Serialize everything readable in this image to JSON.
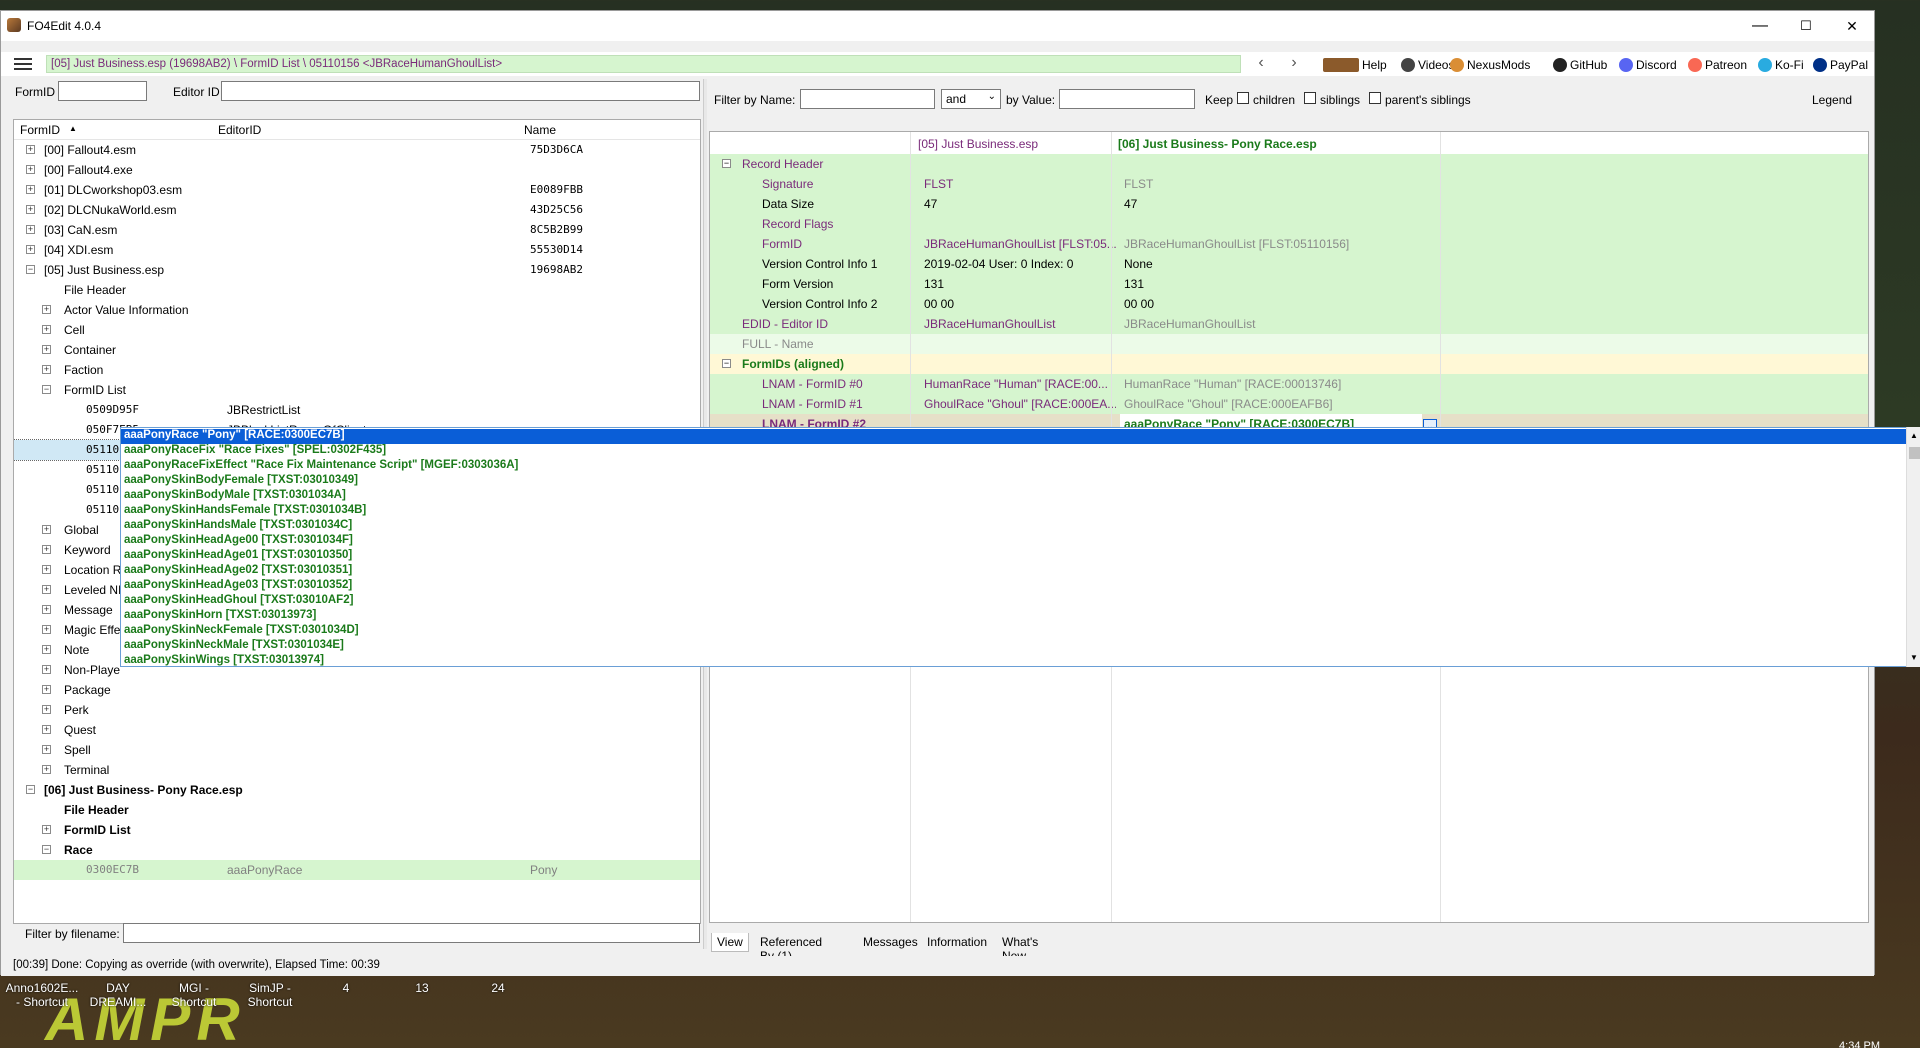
{
  "window": {
    "title": "FO4Edit 4.0.4",
    "min": "—",
    "max": "☐",
    "close": "✕"
  },
  "toolbar": {
    "path": "[05] Just Business.esp (19698AB2) \\ FormID List \\ 05110156 <JBRaceHumanGhoulList>",
    "back": "‹",
    "forward": "›",
    "links": [
      {
        "label": "Help",
        "icon": "book-icon"
      },
      {
        "label": "Videos",
        "icon": "videos-icon"
      },
      {
        "label": "NexusMods",
        "icon": "nexusmods-icon"
      },
      {
        "label": "GitHub",
        "icon": "github-icon"
      },
      {
        "label": "Discord",
        "icon": "discord-icon"
      },
      {
        "label": "Patreon",
        "icon": "patreon-icon"
      },
      {
        "label": "Ko-Fi",
        "icon": "kofi-icon"
      },
      {
        "label": "PayPal",
        "icon": "paypal-icon"
      }
    ]
  },
  "left": {
    "formid_label": "FormID",
    "editorid_label": "Editor ID",
    "formid_value": "",
    "editorid_value": "",
    "columns": [
      "FormID",
      "EditorID",
      "Name"
    ],
    "rows": [
      {
        "text": "[00] Fallout4.esm",
        "name": "75D3D6CA",
        "exp": "+",
        "indent": 0
      },
      {
        "text": "[00] Fallout4.exe",
        "name": "",
        "exp": "+",
        "indent": 0
      },
      {
        "text": "[01] DLCworkshop03.esm",
        "name": "E0089FBB",
        "exp": "+",
        "indent": 0
      },
      {
        "text": "[02] DLCNukaWorld.esm",
        "name": "43D25C56",
        "exp": "+",
        "indent": 0
      },
      {
        "text": "[03] CaN.esm",
        "name": "8C5B2B99",
        "exp": "+",
        "indent": 0
      },
      {
        "text": "[04] XDI.esm",
        "name": "55530D14",
        "exp": "+",
        "indent": 0
      },
      {
        "text": "[05] Just Business.esp",
        "name": "19698AB2",
        "exp": "−",
        "indent": 0
      },
      {
        "text": "File Header",
        "name": "",
        "exp": "",
        "indent": 1
      },
      {
        "text": "Actor Value Information",
        "name": "",
        "exp": "+",
        "indent": 1
      },
      {
        "text": "Cell",
        "name": "",
        "exp": "+",
        "indent": 1
      },
      {
        "text": "Container",
        "name": "",
        "exp": "+",
        "indent": 1
      },
      {
        "text": "Faction",
        "name": "",
        "exp": "+",
        "indent": 1
      },
      {
        "text": "FormID List",
        "name": "",
        "exp": "−",
        "indent": 1
      },
      {
        "text": "0509D95F",
        "editor": "JBRestrictList",
        "name": "",
        "exp": "",
        "indent": 2,
        "mono": true
      },
      {
        "text": "050F7EB5",
        "editor": "JBBlackListRacesOfClients",
        "name": "",
        "exp": "",
        "indent": 2,
        "mono": true
      },
      {
        "text": "05110",
        "editor": "",
        "name": "",
        "exp": "",
        "indent": 2,
        "mono": true,
        "selected": true
      },
      {
        "text": "05110",
        "editor": "",
        "name": "",
        "exp": "",
        "indent": 2,
        "mono": true
      },
      {
        "text": "05110",
        "editor": "",
        "name": "",
        "exp": "",
        "indent": 2,
        "mono": true
      },
      {
        "text": "05110",
        "editor": "",
        "name": "",
        "exp": "",
        "indent": 2,
        "mono": true
      },
      {
        "text": "Global",
        "name": "",
        "exp": "+",
        "indent": 1
      },
      {
        "text": "Keyword",
        "name": "",
        "exp": "+",
        "indent": 1
      },
      {
        "text": "Location R",
        "name": "",
        "exp": "+",
        "indent": 1
      },
      {
        "text": "Leveled NI",
        "name": "",
        "exp": "+",
        "indent": 1
      },
      {
        "text": "Message",
        "name": "",
        "exp": "+",
        "indent": 1
      },
      {
        "text": "Magic Effe",
        "name": "",
        "exp": "+",
        "indent": 1
      },
      {
        "text": "Note",
        "name": "",
        "exp": "+",
        "indent": 1
      },
      {
        "text": "Non-Playe",
        "name": "",
        "exp": "+",
        "indent": 1
      },
      {
        "text": "Package",
        "name": "",
        "exp": "+",
        "indent": 1
      },
      {
        "text": "Perk",
        "name": "",
        "exp": "+",
        "indent": 1
      },
      {
        "text": "Quest",
        "name": "",
        "exp": "+",
        "indent": 1
      },
      {
        "text": "Spell",
        "name": "",
        "exp": "+",
        "indent": 1
      },
      {
        "text": "Terminal",
        "name": "",
        "exp": "+",
        "indent": 1
      },
      {
        "text": "[06] Just Business- Pony Race.esp",
        "name": "",
        "exp": "−",
        "indent": 0,
        "bold": true
      },
      {
        "text": "File Header",
        "name": "",
        "exp": "",
        "indent": 1,
        "bold": true
      },
      {
        "text": "FormID List",
        "name": "",
        "exp": "+",
        "indent": 1,
        "bold": true
      },
      {
        "text": "Race",
        "name": "",
        "exp": "−",
        "indent": 1,
        "bold": true
      },
      {
        "text": "0300EC7B",
        "editor": "aaaPonyRace",
        "name": "Pony",
        "exp": "",
        "indent": 2,
        "mono": true,
        "gray": true,
        "highlight": true
      }
    ],
    "filter_label": "Filter by filename:",
    "filter_value": ""
  },
  "right": {
    "filter_name_label": "Filter by Name:",
    "filter_name_value": "",
    "and_select": "and",
    "by_value_label": "by Value:",
    "by_value_value": "",
    "keep_label": "Keep",
    "children": "children",
    "siblings": "siblings",
    "parents": "parent's siblings",
    "legend": "Legend",
    "headers": [
      "[05] Just Business.esp",
      "[06] Just Business- Pony Race.esp"
    ],
    "rows": [
      {
        "label": "Record Header",
        "v1": "",
        "v2": "",
        "indent": 0,
        "exp": "−",
        "bg": "green",
        "lc": "purple"
      },
      {
        "label": "Signature",
        "v1": "FLST",
        "v2": "FLST",
        "indent": 1,
        "bg": "green",
        "lc": "purple",
        "c1": "purple",
        "c2": "grey"
      },
      {
        "label": "Data Size",
        "v1": "47",
        "v2": "47",
        "indent": 1,
        "bg": "green",
        "lc": "black",
        "c1": "black",
        "c2": "black"
      },
      {
        "label": "Record Flags",
        "v1": "",
        "v2": "",
        "indent": 1,
        "bg": "green",
        "lc": "purple"
      },
      {
        "label": "FormID",
        "v1": "JBRaceHumanGhoulList [FLST:05...",
        "v2": "JBRaceHumanGhoulList [FLST:05110156]",
        "indent": 1,
        "bg": "green",
        "lc": "purple",
        "c1": "purple",
        "c2": "grey"
      },
      {
        "label": "Version Control Info 1",
        "v1": "2019-02-04 User: 0 Index: 0",
        "v2": "None",
        "indent": 1,
        "bg": "green",
        "lc": "black",
        "c1": "black",
        "c2": "black"
      },
      {
        "label": "Form Version",
        "v1": "131",
        "v2": "131",
        "indent": 1,
        "bg": "green",
        "lc": "black",
        "c1": "black",
        "c2": "black"
      },
      {
        "label": "Version Control Info 2",
        "v1": "00 00",
        "v2": "00 00",
        "indent": 1,
        "bg": "green",
        "lc": "black",
        "c1": "black",
        "c2": "black"
      },
      {
        "label": "EDID - Editor ID",
        "v1": "JBRaceHumanGhoulList",
        "v2": "JBRaceHumanGhoulList",
        "indent": 0,
        "bg": "green",
        "lc": "purple",
        "c1": "purple",
        "c2": "grey"
      },
      {
        "label": "FULL - Name",
        "v1": "",
        "v2": "",
        "indent": 0,
        "bg": "lightg",
        "lc": "grey"
      },
      {
        "label": "FormIDs (aligned)",
        "v1": "",
        "v2": "",
        "indent": 0,
        "exp": "−",
        "bg": "yellow",
        "lc": "dgreen",
        "bold": true
      },
      {
        "label": "LNAM - FormID #0",
        "v1": "HumanRace \"Human\" [RACE:00...",
        "v2": "HumanRace \"Human\" [RACE:00013746]",
        "indent": 1,
        "bg": "green",
        "lc": "purple",
        "c1": "purple",
        "c2": "grey"
      },
      {
        "label": "LNAM - FormID #1",
        "v1": "GhoulRace \"Ghoul\" [RACE:000EA...",
        "v2": "GhoulRace \"Ghoul\" [RACE:000EAFB6]",
        "indent": 1,
        "bg": "green",
        "lc": "purple",
        "c1": "purple",
        "c2": "grey"
      },
      {
        "label": "LNAM - FormID #2",
        "v1": "",
        "v2": "aaaPonyRace \"Pony\" [RACE:0300EC7B]",
        "indent": 1,
        "bg": "edit",
        "lc": "purple",
        "bold": true,
        "c2": "dgreen"
      }
    ],
    "tabs": [
      "View",
      "Referenced By (1)",
      "Messages",
      "Information",
      "What's New"
    ]
  },
  "dropdown": {
    "items": [
      "aaaPonyRace \"Pony\" [RACE:0300EC7B]",
      "aaaPonyRaceFix \"Race Fixes\" [SPEL:0302F435]",
      "aaaPonyRaceFixEffect \"Race Fix Maintenance Script\" [MGEF:0303036A]",
      "aaaPonySkinBodyFemale [TXST:03010349]",
      "aaaPonySkinBodyMale [TXST:0301034A]",
      "aaaPonySkinHandsFemale [TXST:0301034B]",
      "aaaPonySkinHandsMale [TXST:0301034C]",
      "aaaPonySkinHeadAge00 [TXST:0301034F]",
      "aaaPonySkinHeadAge01 [TXST:03010350]",
      "aaaPonySkinHeadAge02 [TXST:03010351]",
      "aaaPonySkinHeadAge03 [TXST:03010352]",
      "aaaPonySkinHeadGhoul [TXST:03010AF2]",
      "aaaPonySkinHorn [TXST:03013973]",
      "aaaPonySkinNeckFemale [TXST:0301034D]",
      "aaaPonySkinNeckMale [TXST:0301034E]",
      "aaaPonySkinWings [TXST:03013974]"
    ]
  },
  "status": "[00:39] Done: Copying as override (with overwrite), Elapsed Time: 00:39",
  "desktop": {
    "icons": [
      {
        "l1": "Anno1602E...",
        "l2": "- Shortcut"
      },
      {
        "l1": "DAY",
        "l2": "DREAMI..."
      },
      {
        "l1": "MGI -",
        "l2": "Shortcut"
      },
      {
        "l1": "SimJP -",
        "l2": "Shortcut"
      },
      {
        "l1": "4",
        "l2": ""
      },
      {
        "l1": "13",
        "l2": ""
      },
      {
        "l1": "24",
        "l2": ""
      }
    ],
    "wallpaper_text": "AMPR",
    "clock": "4:34 PM"
  }
}
